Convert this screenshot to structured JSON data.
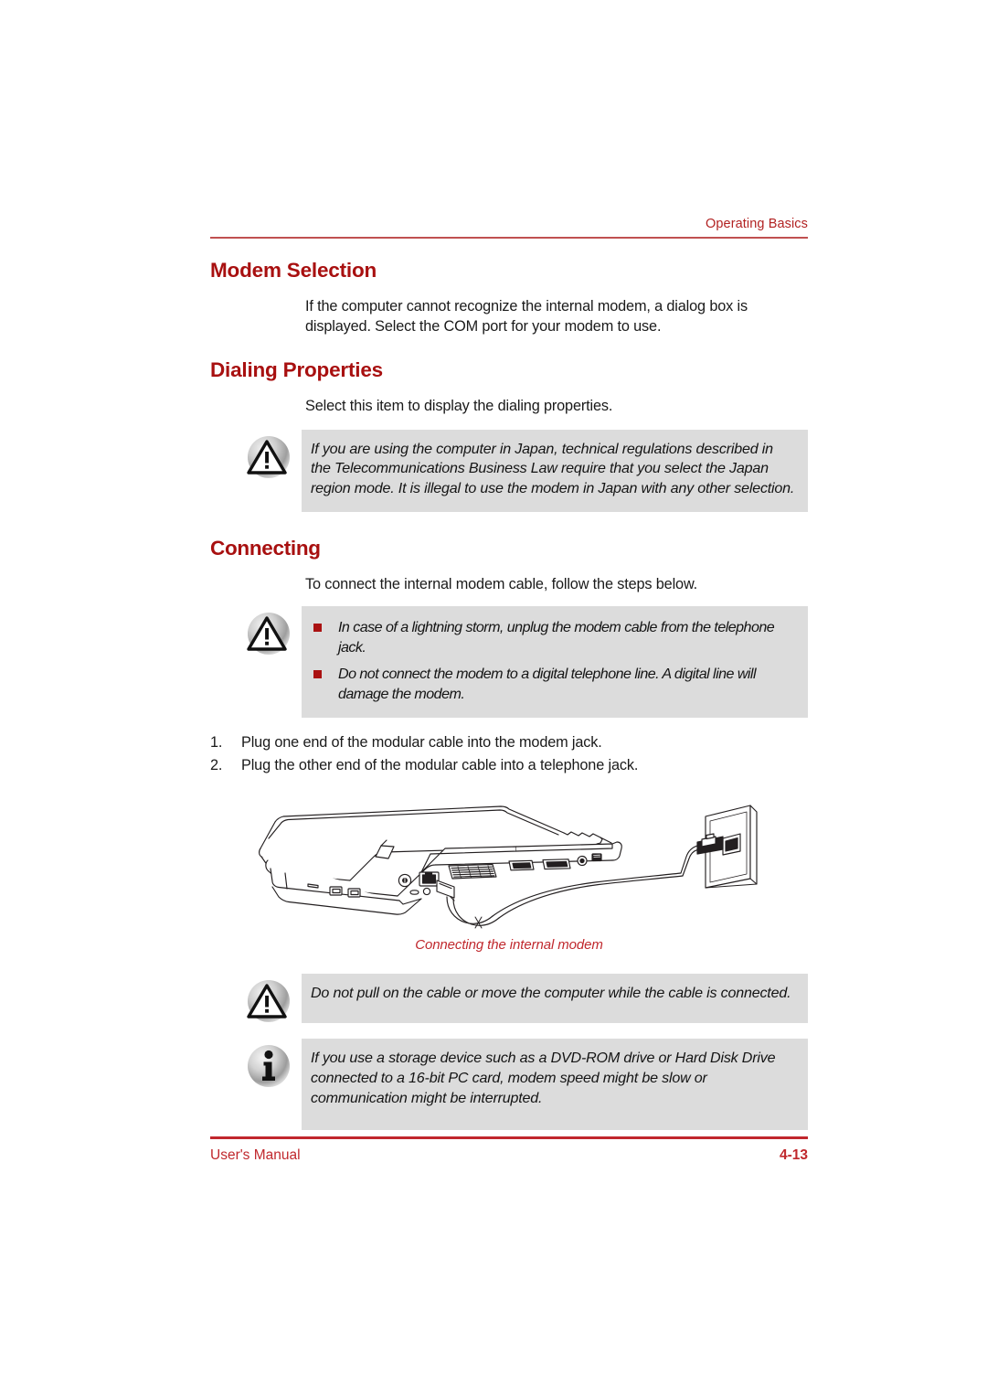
{
  "page": {
    "running_header": "Operating Basics",
    "footer_left": "User's Manual",
    "footer_page": "4-13",
    "accent_red": "#a81010",
    "rule_red": "#c1272d",
    "notice_bg": "#dcdcdc",
    "bullet_red": "#aa1111"
  },
  "sections": {
    "modem_selection": {
      "heading": "Modem Selection",
      "body": "If the computer cannot recognize the internal modem, a dialog box is displayed. Select the COM port for your modem to use."
    },
    "dialing_properties": {
      "heading": "Dialing Properties",
      "body": "Select this item to display the dialing properties.",
      "caution": {
        "icon": "warning-triangle-icon",
        "text": "If you are using the computer in Japan, technical regulations described in the Telecommunications Business Law require that you select the Japan region mode. It is illegal to use the modem in Japan with any other selection."
      }
    },
    "connecting": {
      "heading": "Connecting",
      "body": "To connect the internal modem cable, follow the steps below.",
      "caution": {
        "icon": "warning-triangle-icon",
        "bullets": [
          "In case of a lightning storm, unplug the modem cable from the telephone jack.",
          "Do not connect the modem to a digital telephone line. A digital line will damage the modem."
        ]
      },
      "steps": [
        {
          "number": "1.",
          "text": "Plug one end of the modular cable into the modem jack."
        },
        {
          "number": "2.",
          "text": "Plug the other end of the modular cable into a telephone jack."
        }
      ],
      "figure": {
        "caption": "Connecting the internal modem",
        "alt": "Line drawing of a notebook computer with a modular cable plugged into its modem jack and into a telephone wall jack"
      },
      "caution2": {
        "icon": "warning-triangle-icon",
        "text": "Do not pull on the cable or move the computer while the cable is connected."
      },
      "note": {
        "icon": "info-icon",
        "text": "If you use a storage device such as a DVD-ROM drive or Hard Disk Drive connected to a 16-bit PC card, modem speed might be slow or communication might be interrupted."
      }
    }
  }
}
